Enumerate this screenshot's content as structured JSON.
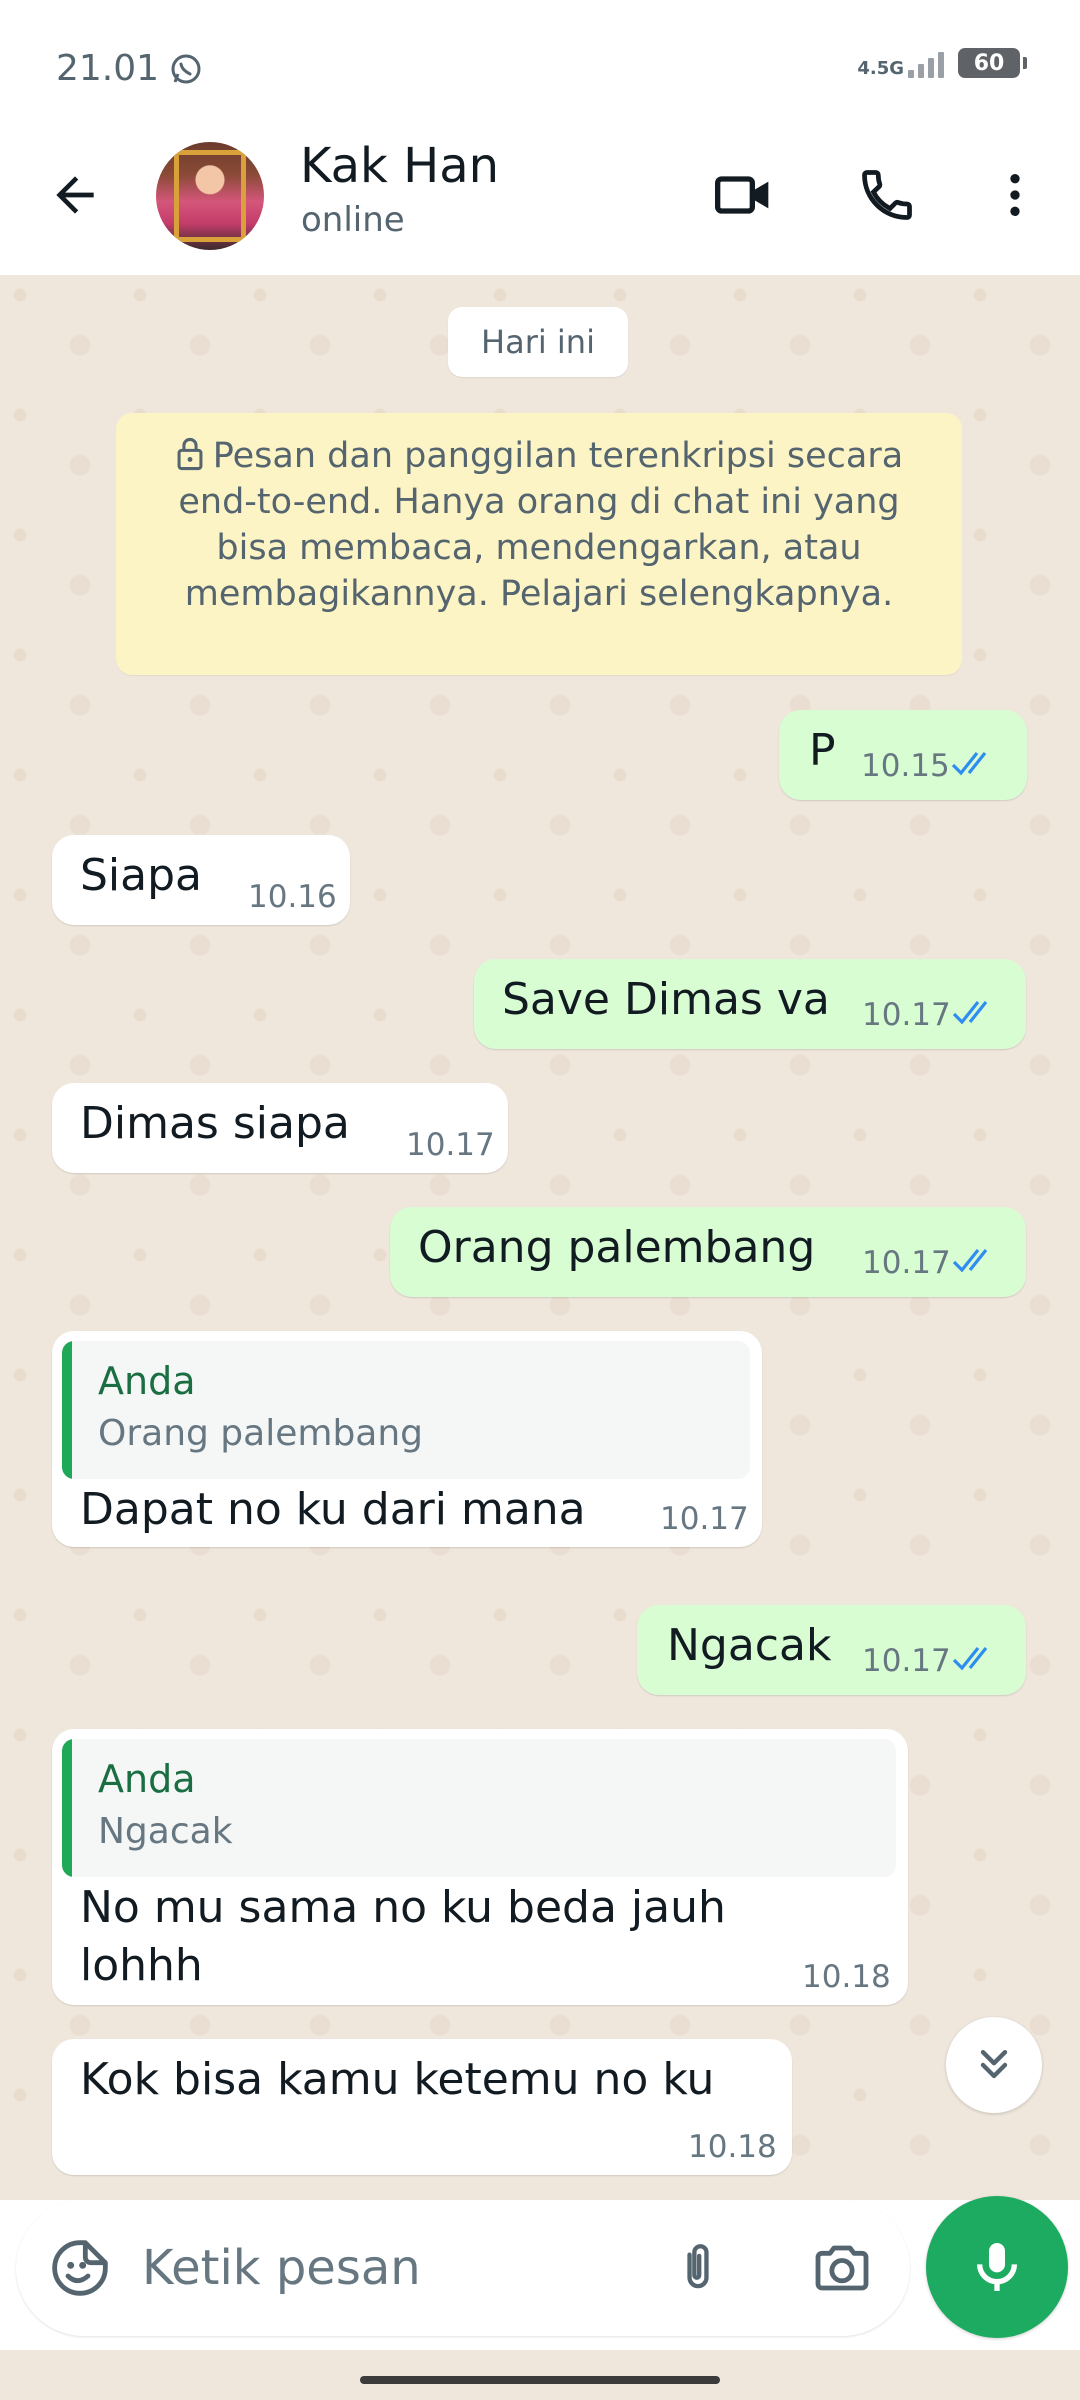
{
  "status_bar": {
    "time": "21.01",
    "network": "4.5G",
    "battery": "60"
  },
  "header": {
    "contact_name": "Kak Han",
    "contact_status": "online"
  },
  "chat": {
    "date_chip": "Hari ini",
    "encryption_notice": "Pesan dan panggilan terenkripsi secara end-to-end. Hanya orang di chat ini yang bisa membaca, mendengarkan, atau membagikannya. Pelajari selengkapnya.",
    "messages": [
      {
        "direction": "out",
        "text": "P",
        "time": "10.15",
        "status": "read"
      },
      {
        "direction": "in",
        "text": "Siapa",
        "time": "10.16"
      },
      {
        "direction": "out",
        "text": "Save Dimas va",
        "time": "10.17",
        "status": "read"
      },
      {
        "direction": "in",
        "text": "Dimas siapa",
        "time": "10.17"
      },
      {
        "direction": "out",
        "text": "Orang palembang",
        "time": "10.17",
        "status": "read"
      },
      {
        "direction": "in",
        "quote_author": "Anda",
        "quote_text": "Orang palembang",
        "text": "Dapat no ku dari mana",
        "time": "10.17"
      },
      {
        "direction": "out",
        "text": "Ngacak",
        "time": "10.17",
        "status": "read"
      },
      {
        "direction": "in",
        "quote_author": "Anda",
        "quote_text": "Ngacak",
        "text_line1": "No mu sama no ku beda jauh",
        "text_line2": "lohhh",
        "time": "10.18"
      },
      {
        "direction": "in",
        "text": "Kok bisa kamu ketemu no ku",
        "time": "10.18"
      }
    ]
  },
  "composer": {
    "placeholder": "Ketik pesan"
  },
  "colors": {
    "outgoing_bubble": "#d9fdd3",
    "incoming_bubble": "#ffffff",
    "chat_background": "#efe7dc",
    "accent_green": "#1daa61",
    "read_ticks": "#2f8cf0",
    "encryption_notice_bg": "#fdf4c5"
  },
  "icons": {
    "back": "arrow-left-icon",
    "video_call": "video-camera-icon",
    "voice_call": "phone-icon",
    "menu": "more-vertical-icon",
    "emoji": "sticker-emoji-icon",
    "attach": "paperclip-icon",
    "camera": "camera-icon",
    "mic": "microphone-icon",
    "scroll_down": "double-chevron-down-icon",
    "lock": "lock-icon"
  }
}
